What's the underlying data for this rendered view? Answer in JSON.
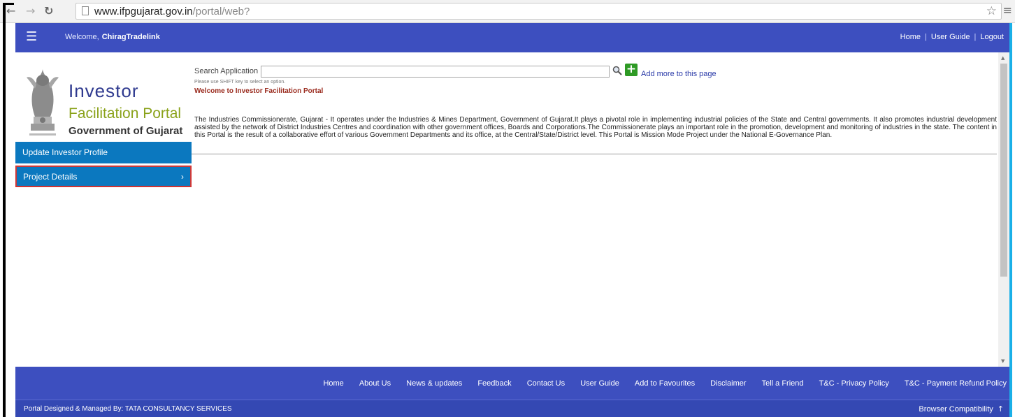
{
  "browser": {
    "url_host": "www.ifpgujarat.gov.in",
    "url_path": "/portal/web?"
  },
  "header": {
    "welcome_label": "Welcome,",
    "user_name": "ChiragTradelink",
    "links": [
      "Home",
      "User Guide",
      "Logout"
    ]
  },
  "logo": {
    "line1": "Investor",
    "line2": "Facilitation Portal",
    "line3": "Government of Gujarat"
  },
  "sidebar": {
    "items": [
      {
        "label": "Update Investor Profile"
      },
      {
        "label": "Project Details",
        "chevron": "›"
      }
    ]
  },
  "search": {
    "label": "Search Application",
    "value": "",
    "hint": "Please use SHIFT key to select an option.",
    "add_more": "Add more to this page"
  },
  "main": {
    "welcome_msg": "Welcome to Investor Facilitation Portal",
    "intro": "The Industries Commissionerate, Gujarat - It operates under the Industries & Mines Department, Government of Gujarat.It plays a pivotal role in implementing industrial policies of the State and Central governments. It also promotes industrial development assisted by the network of District Industries Centres and coordination with other government offices, Boards and Corporations.The Commissionerate plays an important role in the promotion, development and monitoring of industries in the state. The content in this Portal is the result of a collaborative effort of various Government Departments and its office, at the Central/State/District level. This Portal is Mission Mode Project under the National E-Governance Plan."
  },
  "footer": {
    "links": [
      "Home",
      "About Us",
      "News & updates",
      "Feedback",
      "Contact Us",
      "User Guide",
      "Add to Favourites",
      "Disclaimer",
      "Tell a Friend",
      "T&C - Privacy Policy",
      "T&C - Payment Refund Policy"
    ],
    "credit": "Portal Designed & Managed By: TATA CONSULTANCY SERVICES",
    "compat": "Browser Compatibility"
  },
  "colors": {
    "header_bg": "#3d4fbf",
    "sidebar_bg": "#0b78bf",
    "frame_border": "#1ab0e8",
    "highlight": "#d12b2b"
  }
}
